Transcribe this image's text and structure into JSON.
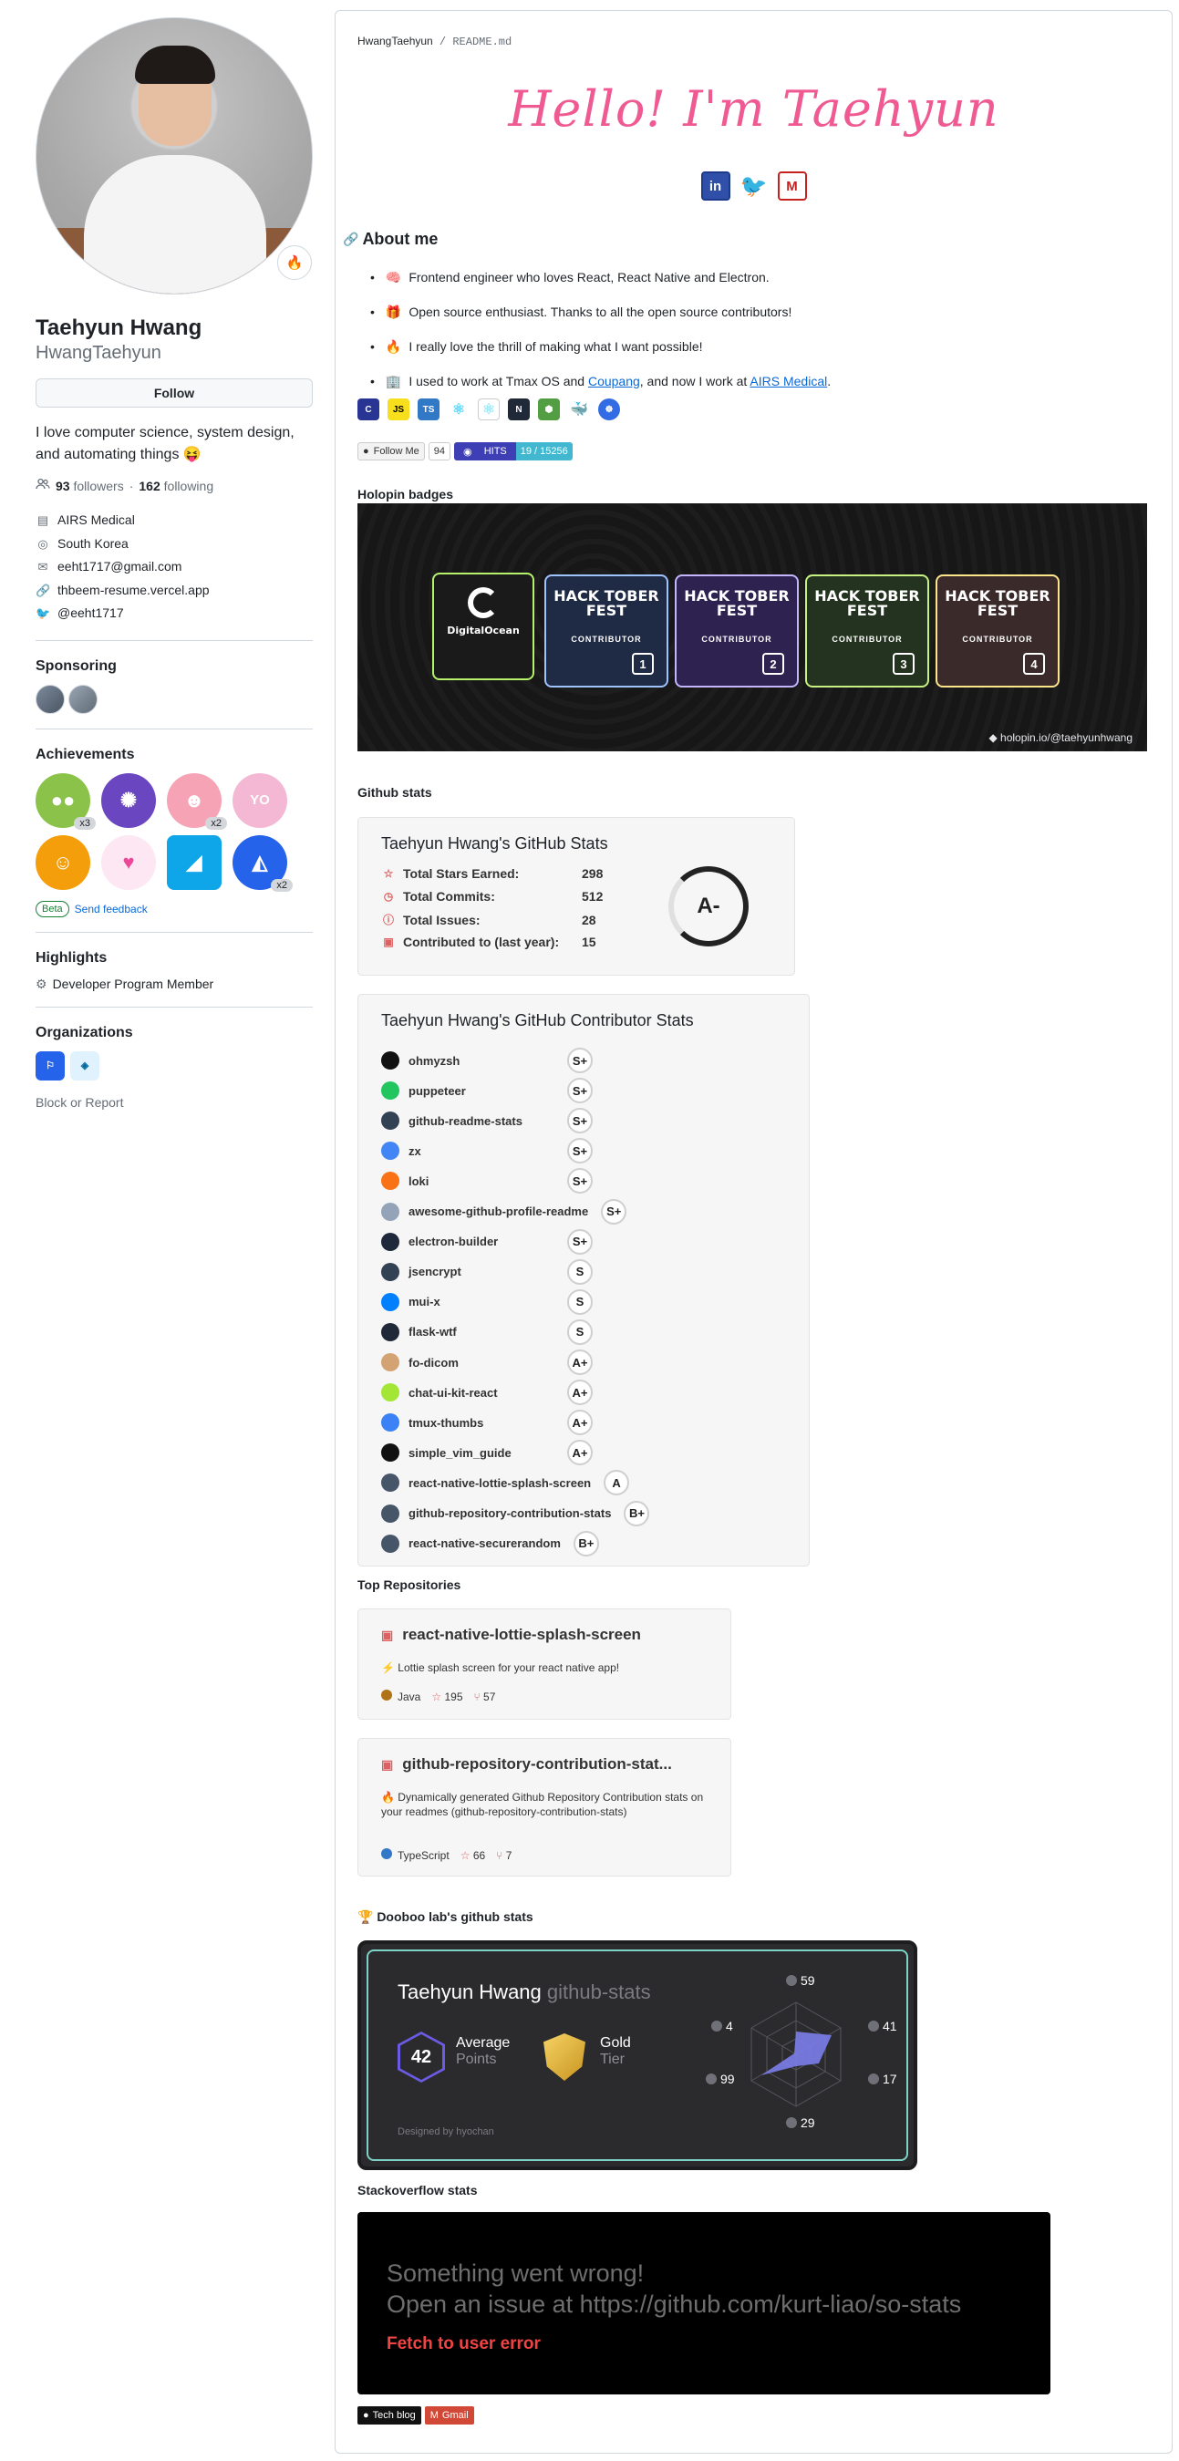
{
  "profile": {
    "status_emoji": "🔥",
    "full_name": "Taehyun Hwang",
    "username": "HwangTaehyun",
    "follow_label": "Follow",
    "bio": "I love computer science, system design, and automating things 😝",
    "followers_count": "93",
    "followers_label": "followers",
    "separator": "·",
    "following_count": "162",
    "following_label": "following",
    "company": "AIRS Medical",
    "location": "South Korea",
    "email": "eeht1717@gmail.com",
    "website": "thbeem-resume.vercel.app",
    "twitter": "@eeht1717"
  },
  "sponsoring": {
    "title": "Sponsoring"
  },
  "achievements": {
    "title": "Achievements",
    "badges": [
      {
        "name": "pair-extraordinaire",
        "count": "x3",
        "color": "#8bc34a"
      },
      {
        "name": "galaxy-brain",
        "count": "",
        "color": "#6b46c1"
      },
      {
        "name": "starstruck",
        "count": "x2",
        "color": "#f5a3b5"
      },
      {
        "name": "yolo",
        "count": "",
        "color": "#f4b8d4"
      },
      {
        "name": "quickdraw",
        "count": "",
        "color": "#f59e0b"
      },
      {
        "name": "heart-on-your-sleeve",
        "count": "",
        "color": "#f9a8d4"
      },
      {
        "name": "public-sponsor",
        "count": "",
        "color": "#0ea5e9"
      },
      {
        "name": "pull-shark",
        "count": "x2",
        "color": "#2563eb"
      }
    ],
    "beta_label": "Beta",
    "feedback_label": "Send feedback"
  },
  "highlights": {
    "title": "Highlights",
    "item": "Developer Program Member"
  },
  "organizations": {
    "title": "Organizations",
    "block_label": "Block or Report"
  },
  "readme": {
    "path_user": "HwangTaehyun",
    "path_sep": " / ",
    "path_file": "README",
    "path_ext": ".md",
    "hello": "Hello! I'm Taehyun",
    "about_title": "About me",
    "about": {
      "item1": "Frontend engineer who loves React, React Native and Electron.",
      "item2": "Open source enthusiast. Thanks to all the open source contributors!",
      "item3": "I really love the thrill of making what I want possible!",
      "item4_pre": "I used to work at Tmax OS and ",
      "item4_link1": "Coupang",
      "item4_mid": ", and now I work at ",
      "item4_link2": "AIRS Medical",
      "item4_post": "."
    },
    "tech_icons": [
      "C",
      "JS",
      "TS",
      "React",
      "Electron",
      "Next",
      "Node",
      "Docker",
      "K8s"
    ],
    "badges": {
      "follow_label": "Follow Me",
      "follow_count": "94",
      "hits_label": "HITS",
      "hits_value": "19 / 15256"
    },
    "holopin_title": "Holopin badges",
    "holopin": {
      "do_title": "DigitalOcean",
      "hack_title": "HACK TOBER FEST",
      "contributor": "CONTRIBUTOR",
      "levels": [
        "1",
        "2",
        "3",
        "4"
      ],
      "credit": "holopin.io/@taehyunhwang"
    },
    "github_stats_title": "Github stats",
    "stats_card": {
      "title": "Taehyun Hwang's GitHub Stats",
      "stars_label": "Total Stars Earned:",
      "stars": "298",
      "commits_label": "Total Commits:",
      "commits": "512",
      "issues_label": "Total Issues:",
      "issues": "28",
      "contrib_label": "Contributed to (last year):",
      "contrib": "15",
      "rank": "A-"
    },
    "contrib_card": {
      "title": "Taehyun Hwang's GitHub Contributor Stats",
      "repos": [
        {
          "name": "ohmyzsh",
          "grade": "S+",
          "color": "#111"
        },
        {
          "name": "puppeteer",
          "grade": "S+",
          "color": "#22c55e"
        },
        {
          "name": "github-readme-stats",
          "grade": "S+",
          "color": "#334155"
        },
        {
          "name": "zx",
          "grade": "S+",
          "color": "#4285f4"
        },
        {
          "name": "loki",
          "grade": "S+",
          "color": "#f97316"
        },
        {
          "name": "awesome-github-profile-readme",
          "grade": "S+",
          "color": "#94a3b8"
        },
        {
          "name": "electron-builder",
          "grade": "S+",
          "color": "#1e293b"
        },
        {
          "name": "jsencrypt",
          "grade": "S",
          "color": "#334155"
        },
        {
          "name": "mui-x",
          "grade": "S",
          "color": "#007fff"
        },
        {
          "name": "flask-wtf",
          "grade": "S",
          "color": "#1f2937"
        },
        {
          "name": "fo-dicom",
          "grade": "A+",
          "color": "#d4a373"
        },
        {
          "name": "chat-ui-kit-react",
          "grade": "A+",
          "color": "#a3e635"
        },
        {
          "name": "tmux-thumbs",
          "grade": "A+",
          "color": "#3b82f6"
        },
        {
          "name": "simple_vim_guide",
          "grade": "A+",
          "color": "#111"
        },
        {
          "name": "react-native-lottie-splash-screen",
          "grade": "A",
          "color": "#475569"
        },
        {
          "name": "github-repository-contribution-stats",
          "grade": "B+",
          "color": "#475569"
        },
        {
          "name": "react-native-securerandom",
          "grade": "B+",
          "color": "#475569"
        }
      ]
    },
    "top_repos_title": "Top Repositories",
    "pins": [
      {
        "title": "react-native-lottie-splash-screen",
        "desc": "⚡ Lottie splash screen for your react native app!",
        "lang": "Java",
        "lang_color": "#b07219",
        "stars": "195",
        "forks": "57"
      },
      {
        "title": "github-repository-contribution-stat...",
        "desc": "🔥 Dynamically generated Github Repository Contribution stats on your readmes (github-repository-contribution-stats)",
        "lang": "TypeScript",
        "lang_color": "#3178c6",
        "stars": "66",
        "forks": "7"
      }
    ],
    "dooboo_title": "🏆 Dooboo lab's github stats",
    "dooboo": {
      "name": "Taehyun Hwang",
      "suffix": "github-stats",
      "score": "42",
      "score_label": "Average",
      "score_sub": "Points",
      "tier_label": "Gold",
      "tier_sub": "Tier",
      "footer": "Designed by hyochan",
      "radar": [
        "59",
        "41",
        "17",
        "29",
        "99",
        "4"
      ]
    },
    "so_title": "Stackoverflow stats",
    "so": {
      "line1": "Something went wrong!",
      "line2": "Open an issue at https://github.com/kurt-liao/so-stats",
      "fetch": "Fetch to user error"
    },
    "bottom_badges": {
      "tech_blog": "Tech blog",
      "gmail": "Gmail"
    }
  }
}
